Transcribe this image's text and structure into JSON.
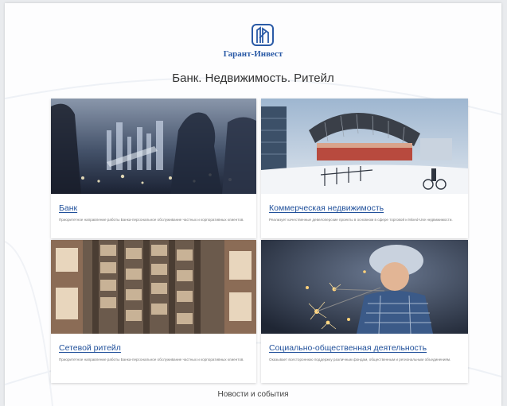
{
  "brand": {
    "name": "Гарант-Инвест",
    "logo_icon": "logo-building-icon",
    "color": "#2a5aa6"
  },
  "tagline": "Банк. Недвижимость. Ритейл",
  "cards": [
    {
      "title": "Банк",
      "description": "Приоритетное направление работы Банка-персональное обслуживание частных и корпоративных клиентов.",
      "image": "business-people-city-night-photo"
    },
    {
      "title": "Коммерческая недвижимость",
      "description": "Реализует качественные девелоперские проекты в основном в сфере торговой и Mixed-Use недвижимости.",
      "image": "modern-station-architecture-photo"
    },
    {
      "title": "Сетевой ритейл",
      "description": "Приоритетное направление работы Банка-персональное обслуживание частных и корпоративных клиентов.",
      "image": "retail-aerial-store-photo"
    },
    {
      "title": "Социально-общественная деятельность",
      "description": "Оказывает всестороннюю поддержку различным фондам, общественным и региональным объединениям.",
      "image": "child-with-sparklers-photo"
    }
  ],
  "news_heading": "Новости и события",
  "colors": {
    "link": "#1f4f9a",
    "background": "#fdfdfe"
  }
}
